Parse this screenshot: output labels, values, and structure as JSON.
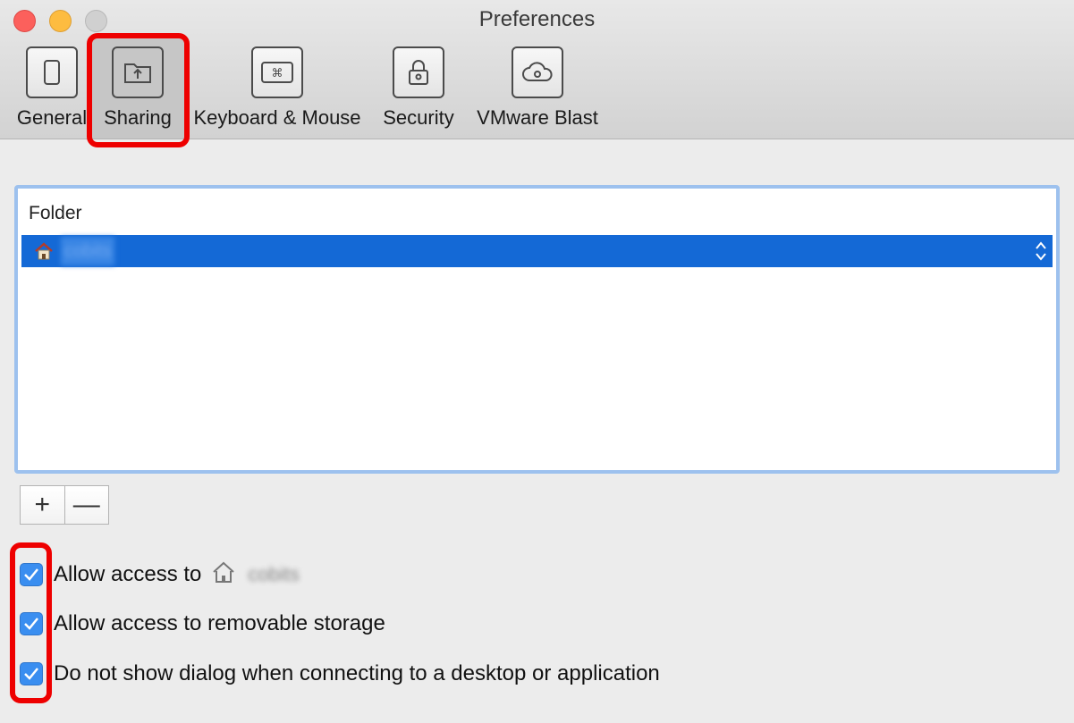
{
  "window": {
    "title": "Preferences"
  },
  "tabs": [
    {
      "label": "General",
      "icon": "device-icon"
    },
    {
      "label": "Sharing",
      "icon": "shared-folder-icon",
      "selected": true
    },
    {
      "label": "Keyboard & Mouse",
      "icon": "keyboard-command-icon"
    },
    {
      "label": "Security",
      "icon": "lock-icon"
    },
    {
      "label": "VMware Blast",
      "icon": "cloud-gear-icon"
    }
  ],
  "folder_table": {
    "column_header": "Folder",
    "rows": [
      {
        "name": "cobits",
        "icon": "home-icon",
        "selected": true
      }
    ]
  },
  "buttons": {
    "add": "+",
    "remove": "—"
  },
  "options": [
    {
      "label": "Allow access to",
      "folder_name": "cobits",
      "checked": true
    },
    {
      "label": "Allow access to removable storage",
      "checked": true
    },
    {
      "label": "Do not show dialog when connecting to a desktop or application",
      "checked": true
    }
  ],
  "colors": {
    "selection": "#1469d6",
    "accent": "#3a8ef0",
    "highlight": "#ee0000",
    "focus_ring": "#9dc1ee"
  }
}
